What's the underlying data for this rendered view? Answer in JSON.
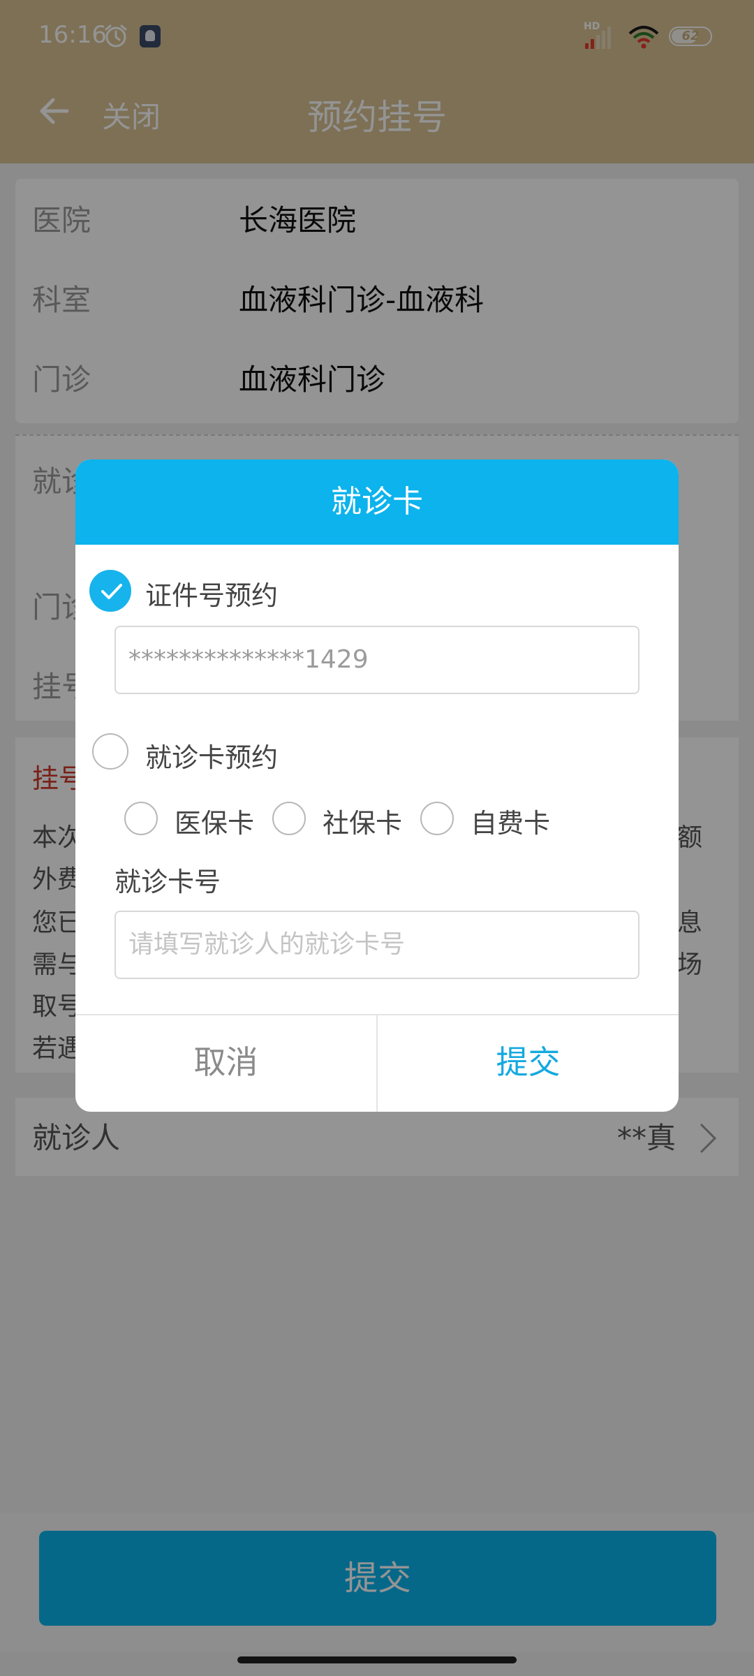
{
  "status_bar": {
    "time": "16:16",
    "battery": "62",
    "network": "HD",
    "icons": [
      "alarm-icon",
      "app-badge-icon",
      "signal-icon",
      "wifi-icon",
      "battery-icon"
    ]
  },
  "header": {
    "back_icon": "arrow-left-icon",
    "close_label": "关闭",
    "title": "预约挂号"
  },
  "info": {
    "rows": [
      {
        "label": "医院",
        "value": "长海医院"
      },
      {
        "label": "科室",
        "value": "血液科门诊-血液科"
      },
      {
        "label": "门诊",
        "value": "血液科门诊"
      }
    ]
  },
  "slot": {
    "labels": [
      "就诊",
      "门诊",
      "挂号"
    ]
  },
  "notice": {
    "title": "挂号",
    "lines": [
      "本次",
      "外费",
      "您已",
      "需与",
      "取号",
      "若遇"
    ],
    "right_fragments": [
      "额",
      "息",
      "场"
    ]
  },
  "patient": {
    "label": "就诊人",
    "value": "**真"
  },
  "bottom": {
    "submit_label": "提交"
  },
  "dialog": {
    "title": "就诊卡",
    "id_option_label": "证件号预约",
    "id_value": "**************1429",
    "card_option_label": "就诊卡预约",
    "card_types": [
      "医保卡",
      "社保卡",
      "自费卡"
    ],
    "card_number_label": "就诊卡号",
    "card_number_placeholder": "请填写就诊人的就诊卡号",
    "cancel_label": "取消",
    "submit_label": "提交"
  },
  "colors": {
    "header_bg": "#d8c193",
    "accent": "#0cb3ed",
    "notice_title": "#d03a2c"
  }
}
